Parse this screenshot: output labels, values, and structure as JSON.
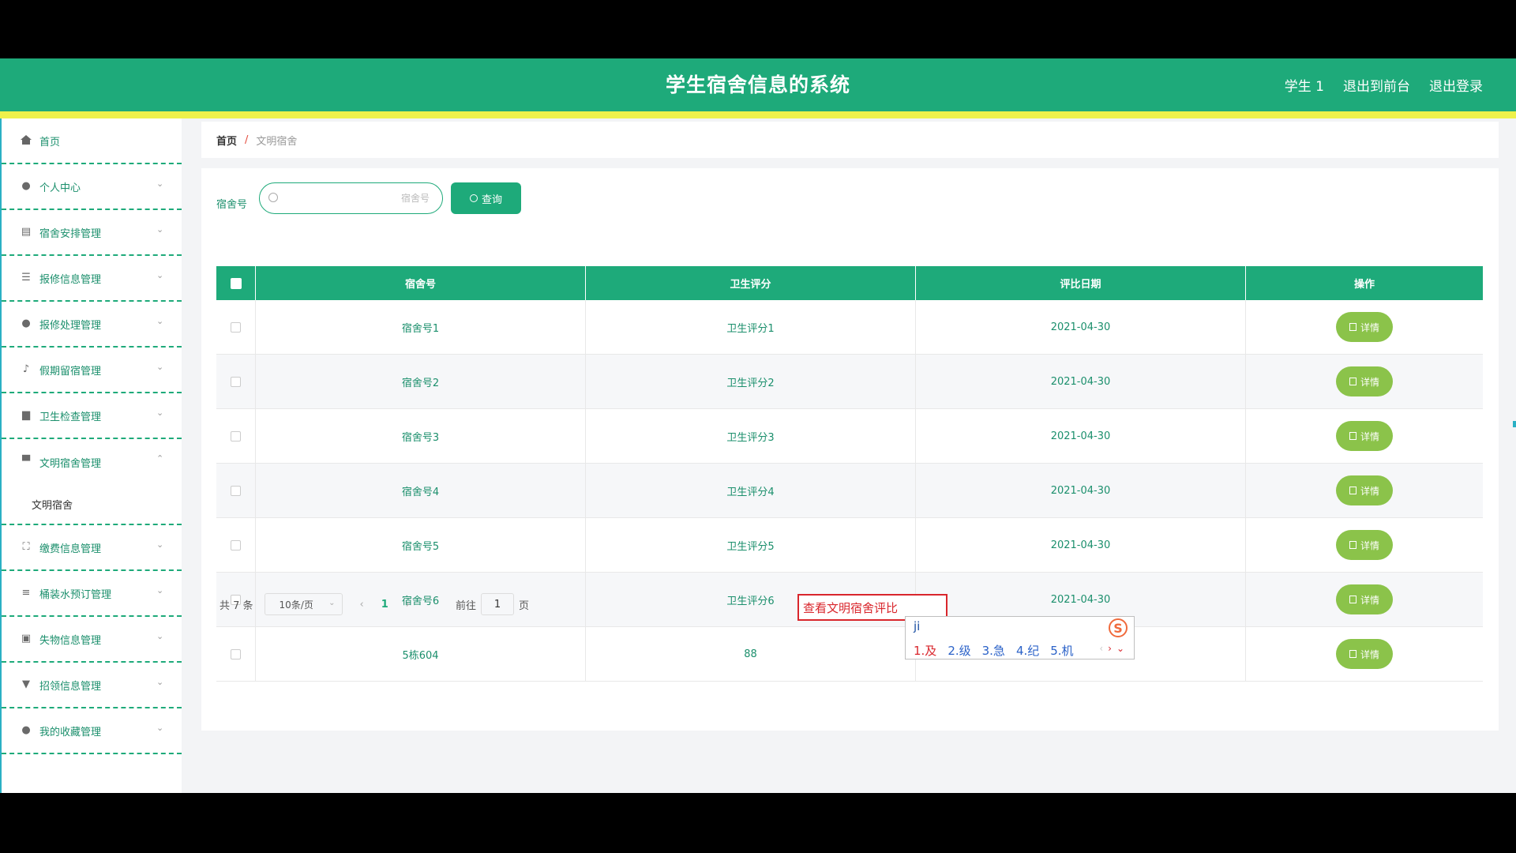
{
  "header": {
    "title": "学生宿舍信息的系统",
    "user": "学生 1",
    "back_to_front": "退出到前台",
    "logout": "退出登录"
  },
  "sidebar": {
    "items": [
      {
        "label": "首页",
        "icon": "home-icon"
      },
      {
        "label": "个人中心",
        "icon": "user-icon"
      },
      {
        "label": "宿舍安排管理",
        "icon": "clipboard-icon"
      },
      {
        "label": "报修信息管理",
        "icon": "sliders-icon"
      },
      {
        "label": "报修处理管理",
        "icon": "user-icon"
      },
      {
        "label": "假期留宿管理",
        "icon": "microphone-icon"
      },
      {
        "label": "卫生检查管理",
        "icon": "briefcase-icon"
      },
      {
        "label": "文明宿舍管理",
        "icon": "monitor-icon"
      },
      {
        "label": "文明宿舍",
        "icon": ""
      },
      {
        "label": "缴费信息管理",
        "icon": "expand-icon"
      },
      {
        "label": "桶装水预订管理",
        "icon": "list-icon"
      },
      {
        "label": "失物信息管理",
        "icon": "chart-icon"
      },
      {
        "label": "招领信息管理",
        "icon": "pin-icon"
      },
      {
        "label": "我的收藏管理",
        "icon": "user-icon"
      }
    ]
  },
  "breadcrumb": {
    "home": "首页",
    "separator": "/",
    "current": "文明宿舍"
  },
  "search": {
    "label": "宿舍号",
    "placeholder": "宿舍号",
    "button": "查询"
  },
  "table": {
    "headers": [
      "宿舍号",
      "卫生评分",
      "评比日期",
      "操作"
    ],
    "rows": [
      {
        "room": "宿舍号1",
        "score": "卫生评分1",
        "date": "2021-04-30"
      },
      {
        "room": "宿舍号2",
        "score": "卫生评分2",
        "date": "2021-04-30"
      },
      {
        "room": "宿舍号3",
        "score": "卫生评分3",
        "date": "2021-04-30"
      },
      {
        "room": "宿舍号4",
        "score": "卫生评分4",
        "date": "2021-04-30"
      },
      {
        "room": "宿舍号5",
        "score": "卫生评分5",
        "date": "2021-04-30"
      },
      {
        "room": "宿舍号6",
        "score": "卫生评分6",
        "date": "2021-04-30"
      },
      {
        "room": "5栋604",
        "score": "88",
        "date": ""
      }
    ],
    "detail_button": "详情"
  },
  "pagination": {
    "total": "共 7 条",
    "page_size": "10条/页",
    "current_page": "1",
    "goto_label": "前往",
    "goto_value": "1",
    "page_suffix": "页"
  },
  "ime": {
    "compose_text": "查看文明宿舍评比",
    "input": "ji",
    "candidates": [
      "1.及",
      "2.级",
      "3.急",
      "4.纪",
      "5.机"
    ],
    "nav_prev": "‹",
    "nav_next": "›",
    "nav_more": "⌄"
  },
  "colors": {
    "primary": "#1eaa7a",
    "accent_stripe": "#eef14b",
    "detail_button": "#8bc34a"
  }
}
